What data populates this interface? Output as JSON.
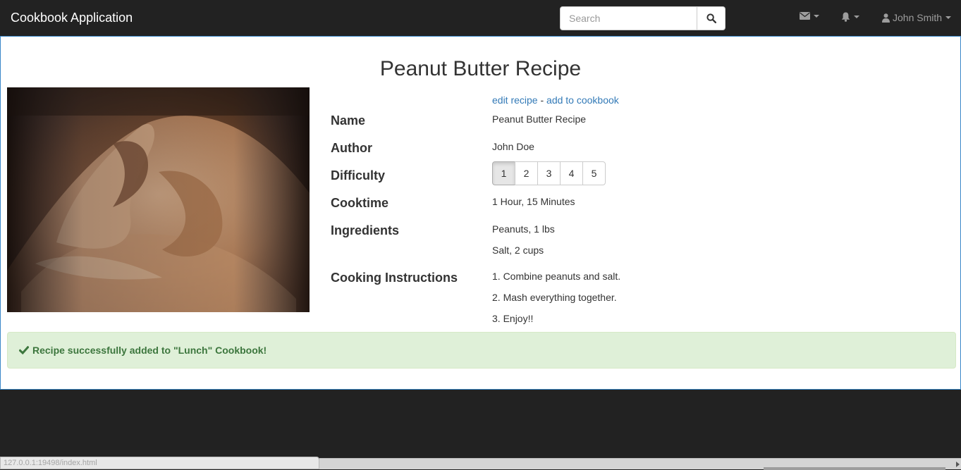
{
  "navbar": {
    "brand": "Cookbook Application",
    "search": {
      "placeholder": "Search",
      "value": ""
    },
    "search_button_icon": "search-icon",
    "messages_icon": "envelope-icon",
    "notifications_icon": "bell-icon",
    "user": {
      "icon": "user-icon",
      "name": "John Smith"
    }
  },
  "recipe": {
    "title": "Peanut Butter Recipe",
    "actions": {
      "edit": "edit recipe",
      "separator": "-",
      "add": "add to cookbook"
    },
    "labels": {
      "name": "Name",
      "author": "Author",
      "difficulty": "Difficulty",
      "cooktime": "Cooktime",
      "ingredients": "Ingredients",
      "instructions": "Cooking Instructions"
    },
    "name": "Peanut Butter Recipe",
    "author": "John Doe",
    "difficulty": {
      "options": [
        "1",
        "2",
        "3",
        "4",
        "5"
      ],
      "selected": "1"
    },
    "cooktime": "1 Hour, 15 Minutes",
    "ingredients": [
      "Peanuts, 1 lbs",
      "Salt, 2 cups"
    ],
    "instructions": [
      "1. Combine peanuts and salt.",
      "2. Mash everything together.",
      "3. Enjoy!!"
    ]
  },
  "alert": {
    "icon": "checkmark-icon",
    "text": "Recipe successfully added to \"Lunch\" Cookbook!"
  },
  "status_bar": {
    "url": "127.0.0.1:19498/index.html"
  },
  "colors": {
    "navbar_bg": "#222222",
    "link": "#337ab7",
    "alert_bg": "#dff0d8",
    "alert_text": "#3c763d",
    "panel_border": "#3a87c8"
  }
}
